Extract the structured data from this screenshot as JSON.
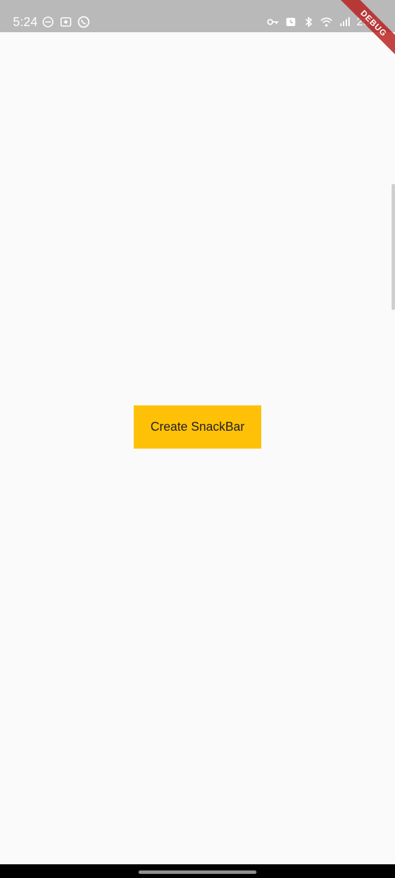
{
  "status_bar": {
    "time": "5:24",
    "battery": "26%",
    "left_icons": [
      "minus-circle-icon",
      "screen-record-icon",
      "whatsapp-icon"
    ],
    "right_icons": [
      "key-icon",
      "alarm-icon",
      "bluetooth-icon",
      "wifi-icon",
      "signal-icon"
    ]
  },
  "debug_banner": {
    "label": "DEBUG"
  },
  "main": {
    "button_label": "Create SnackBar",
    "button_color": "#ffc107"
  }
}
